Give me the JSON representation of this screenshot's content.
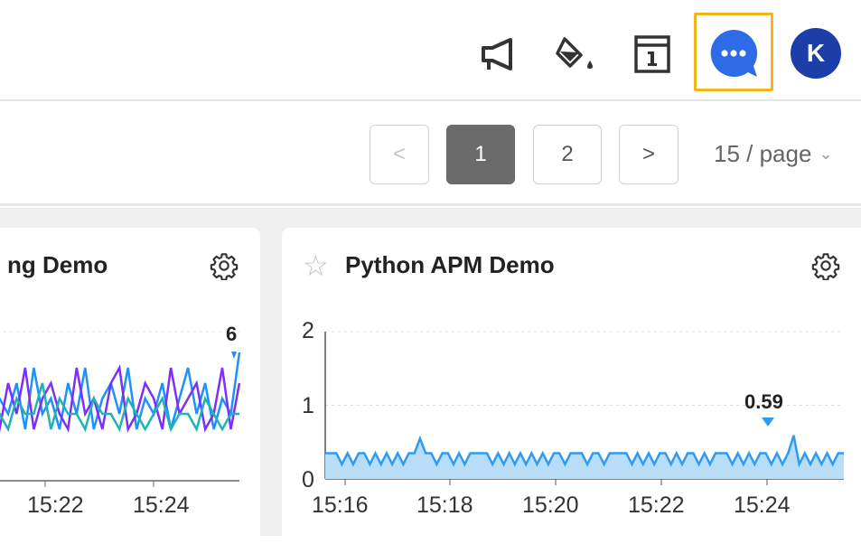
{
  "topbar": {
    "icons": [
      "megaphone-icon",
      "paint-bucket-icon",
      "info-panel-icon",
      "chat-icon"
    ],
    "avatar_letter": "K",
    "highlight_color": "#f2b51a",
    "chat_color": "#2d6ce6",
    "avatar_color": "#1d3da8"
  },
  "pagination": {
    "prev": "<",
    "pages": [
      "1",
      "2"
    ],
    "current": "1",
    "next": ">",
    "page_size": "15 / page"
  },
  "cards": [
    {
      "title": "ng Demo",
      "peak_label": "6",
      "x_ticks": [
        "15:22",
        "15:24"
      ]
    },
    {
      "title": "Python APM Demo",
      "starred": false,
      "peak_label": "0.59",
      "y_ticks": [
        "2",
        "1",
        "0"
      ],
      "x_ticks": [
        "15:16",
        "15:18",
        "15:20",
        "15:22",
        "15:24"
      ]
    }
  ],
  "chart_data": [
    {
      "type": "line",
      "title": "ng Demo",
      "x_ticks": [
        "15:22",
        "15:24"
      ],
      "series_colors": [
        "#1e90ff",
        "#7b2ff7",
        "#1fb3b3"
      ],
      "series": [
        {
          "values": [
            1,
            3,
            2,
            4,
            1,
            5,
            2,
            3,
            1,
            4,
            2,
            5,
            1,
            3,
            4,
            2,
            5,
            1,
            3,
            2,
            4,
            1,
            3,
            5,
            2,
            4,
            1,
            3,
            2,
            6
          ]
        },
        {
          "values": [
            2,
            1,
            4,
            2,
            5,
            1,
            3,
            4,
            2,
            1,
            5,
            2,
            3,
            1,
            4,
            5,
            1,
            2,
            4,
            3,
            1,
            5,
            2,
            3,
            4,
            1,
            2,
            5,
            1,
            4
          ]
        },
        {
          "values": [
            2,
            2,
            1,
            3,
            2,
            2,
            4,
            1,
            3,
            2,
            2,
            1,
            3,
            2,
            2,
            1,
            3,
            2,
            1,
            2,
            3,
            1,
            2,
            2,
            1,
            3,
            2,
            1,
            2,
            2
          ]
        }
      ],
      "peak": 6
    },
    {
      "type": "area",
      "title": "Python APM Demo",
      "ylim": [
        0,
        2
      ],
      "y_ticks": [
        0,
        1,
        2
      ],
      "x_ticks": [
        "15:16",
        "15:18",
        "15:20",
        "15:22",
        "15:24"
      ],
      "series_color": "#2e9bf0",
      "fill_color": "#b9dcf7",
      "values": [
        0.35,
        0.35,
        0.35,
        0.2,
        0.35,
        0.2,
        0.35,
        0.35,
        0.2,
        0.35,
        0.2,
        0.35,
        0.2,
        0.35,
        0.2,
        0.35,
        0.35,
        0.55,
        0.35,
        0.35,
        0.2,
        0.35,
        0.35,
        0.2,
        0.35,
        0.2,
        0.35,
        0.35,
        0.35,
        0.35,
        0.2,
        0.35,
        0.2,
        0.35,
        0.2,
        0.35,
        0.2,
        0.35,
        0.2,
        0.35,
        0.2,
        0.35,
        0.35,
        0.2,
        0.35,
        0.35,
        0.35,
        0.2,
        0.35,
        0.35,
        0.2,
        0.35,
        0.35,
        0.35,
        0.35,
        0.2,
        0.35,
        0.2,
        0.35,
        0.2,
        0.35,
        0.35,
        0.2,
        0.35,
        0.2,
        0.35,
        0.35,
        0.2,
        0.35,
        0.2,
        0.35,
        0.35,
        0.35,
        0.2,
        0.35,
        0.2,
        0.35,
        0.2,
        0.35,
        0.35,
        0.2,
        0.35,
        0.2,
        0.35,
        0.59,
        0.2,
        0.35,
        0.2,
        0.35,
        0.2,
        0.35,
        0.2,
        0.35,
        0.35
      ],
      "peak": 0.59
    }
  ]
}
